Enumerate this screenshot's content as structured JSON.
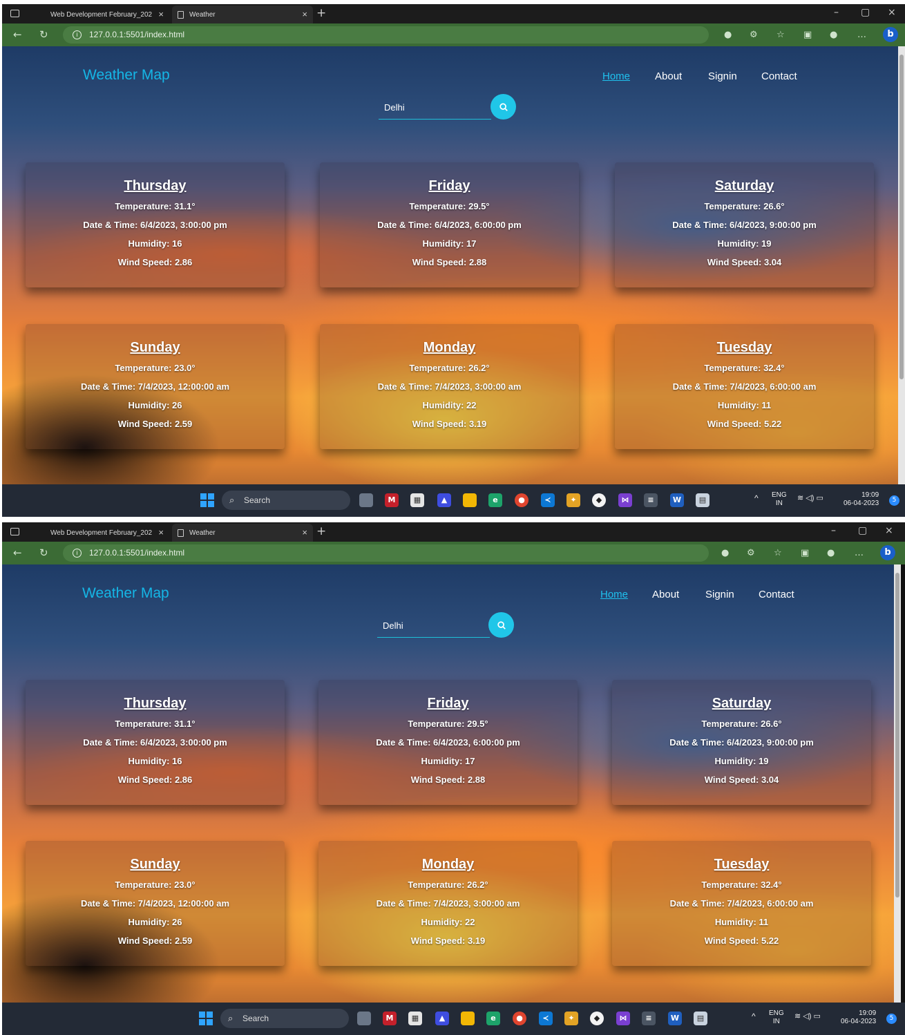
{
  "browser": {
    "tabs": [
      {
        "label": "Web Development February_202"
      },
      {
        "label": "Weather"
      }
    ],
    "url": "127.0.0.1:5501/index.html"
  },
  "site": {
    "brand": "Weather Map",
    "nav": [
      "Home",
      "About",
      "Signin",
      "Contact"
    ],
    "search_value": "Delhi"
  },
  "forecast": [
    {
      "day": "Thursday",
      "temperature": "Temperature: 31.1°",
      "datetime": "Date & Time: 6/4/2023, 3:00:00 pm",
      "humidity": "Humidity: 16",
      "wind": "Wind Speed: 2.86"
    },
    {
      "day": "Friday",
      "temperature": "Temperature: 29.5°",
      "datetime": "Date & Time: 6/4/2023, 6:00:00 pm",
      "humidity": "Humidity: 17",
      "wind": "Wind Speed: 2.88"
    },
    {
      "day": "Saturday",
      "temperature": "Temperature: 26.6°",
      "datetime": "Date & Time: 6/4/2023, 9:00:00 pm",
      "humidity": "Humidity: 19",
      "wind": "Wind Speed: 3.04"
    },
    {
      "day": "Sunday",
      "temperature": "Temperature: 23.0°",
      "datetime": "Date & Time: 7/4/2023, 12:00:00 am",
      "humidity": "Humidity: 26",
      "wind": "Wind Speed: 2.59"
    },
    {
      "day": "Monday",
      "temperature": "Temperature: 26.2°",
      "datetime": "Date & Time: 7/4/2023, 3:00:00 am",
      "humidity": "Humidity: 22",
      "wind": "Wind Speed: 3.19"
    },
    {
      "day": "Tuesday",
      "temperature": "Temperature: 32.4°",
      "datetime": "Date & Time: 7/4/2023, 6:00:00 am",
      "humidity": "Humidity: 11",
      "wind": "Wind Speed: 5.22"
    }
  ],
  "taskbar": {
    "search_label": "Search",
    "lang_top": "ENG",
    "lang_bottom": "IN",
    "time": "19:09",
    "date": "06-04-2023",
    "notifications": "5"
  },
  "colors": {
    "accent": "#20c6e8",
    "brand": "#15b6e6",
    "address_bar": "#3b6b35"
  }
}
